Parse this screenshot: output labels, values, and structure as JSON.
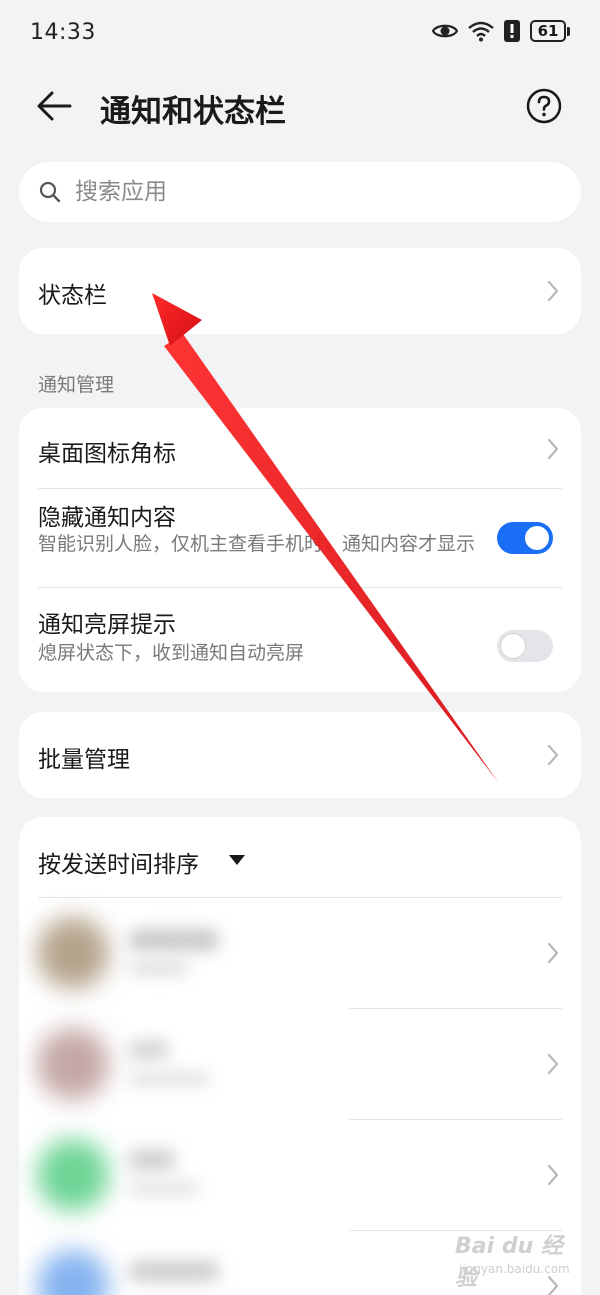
{
  "status_bar": {
    "time": "14:33",
    "battery": "61",
    "icons": [
      "eye-icon",
      "wifi-icon",
      "alert-icon",
      "battery-icon"
    ]
  },
  "header": {
    "title": "通知和状态栏"
  },
  "search": {
    "placeholder": "搜索应用"
  },
  "status_bar_row": {
    "label": "状态栏"
  },
  "notification_section": {
    "label": "通知管理",
    "items": [
      {
        "title": "桌面图标角标"
      },
      {
        "title": "隐藏通知内容",
        "subtitle": "智能识别人脸，仅机主查看手机时，通知内容才显示",
        "switch_on": true
      },
      {
        "title": "通知亮屏提示",
        "subtitle": "熄屏状态下，收到通知自动亮屏",
        "switch_on": false
      }
    ]
  },
  "batch": {
    "label": "批量管理"
  },
  "app_list": {
    "sort_label": "按发送时间排序"
  },
  "watermark": {
    "main": "Bai du 经验",
    "sub": "jingyan.baidu.com"
  },
  "colors": {
    "accent": "#1a6ef5",
    "annotation_arrow": "#e8141b",
    "background": "#f1f3f5"
  }
}
